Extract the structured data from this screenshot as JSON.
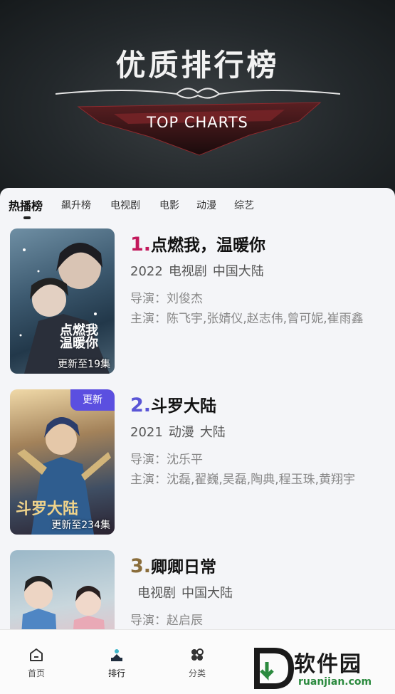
{
  "banner": {
    "title": "优质排行榜",
    "subtitle": "TOP CHARTS"
  },
  "tabs": [
    {
      "label": "热播榜",
      "active": true
    },
    {
      "label": "飙升榜",
      "active": false
    },
    {
      "label": "电视剧",
      "active": false
    },
    {
      "label": "电影",
      "active": false
    },
    {
      "label": "动漫",
      "active": false
    },
    {
      "label": "综艺",
      "active": false
    }
  ],
  "items": [
    {
      "rank": "1.",
      "rank_color": "#c2185b",
      "title": "点燃我，温暖你",
      "year": "2022",
      "genre": "电视剧",
      "region": "中国大陆",
      "director": "导演：刘俊杰",
      "cast": "主演：陈飞宇,张婧仪,赵志伟,曾可妮,崔雨鑫",
      "poster_caption": "更新至19集",
      "poster_text": "点燃我 温暖你"
    },
    {
      "rank": "2.",
      "rank_color": "#5a55d6",
      "title": "斗罗大陆",
      "year": "2021",
      "genre": "动漫",
      "region": "大陆",
      "director": "导演：沈乐平",
      "cast": "主演：沈磊,翟巍,吴磊,陶典,程玉珠,黄翔宇",
      "poster_caption": "更新至234集",
      "poster_badge": "更新",
      "poster_text": "斗罗大陆"
    },
    {
      "rank": "3.",
      "rank_color": "#8a6d3b",
      "title": "卿卿日常",
      "year": "",
      "genre": "电视剧",
      "region": "中国大陆",
      "director": "导演：赵启辰",
      "cast": ""
    }
  ],
  "nav": [
    {
      "label": "首页",
      "icon": "home-icon"
    },
    {
      "label": "排行",
      "icon": "ranking-icon",
      "active": true
    },
    {
      "label": "分类",
      "icon": "category-icon"
    }
  ],
  "watermark": {
    "text": "软件园",
    "sub": "ruanjian.com"
  }
}
